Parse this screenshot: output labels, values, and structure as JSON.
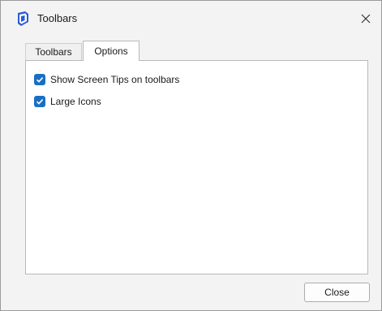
{
  "window": {
    "title": "Toolbars",
    "app_icon": "sketchup-logo-icon",
    "close_icon": "close-icon"
  },
  "tabs": [
    {
      "label": "Toolbars",
      "active": false
    },
    {
      "label": "Options",
      "active": true
    }
  ],
  "options": [
    {
      "label": "Show Screen Tips on toolbars",
      "checked": true
    },
    {
      "label": "Large Icons",
      "checked": true
    }
  ],
  "footer": {
    "close_label": "Close"
  },
  "colors": {
    "accent": "#1a6fc4",
    "window_bg": "#f3f3f3",
    "panel_bg": "#ffffff"
  }
}
